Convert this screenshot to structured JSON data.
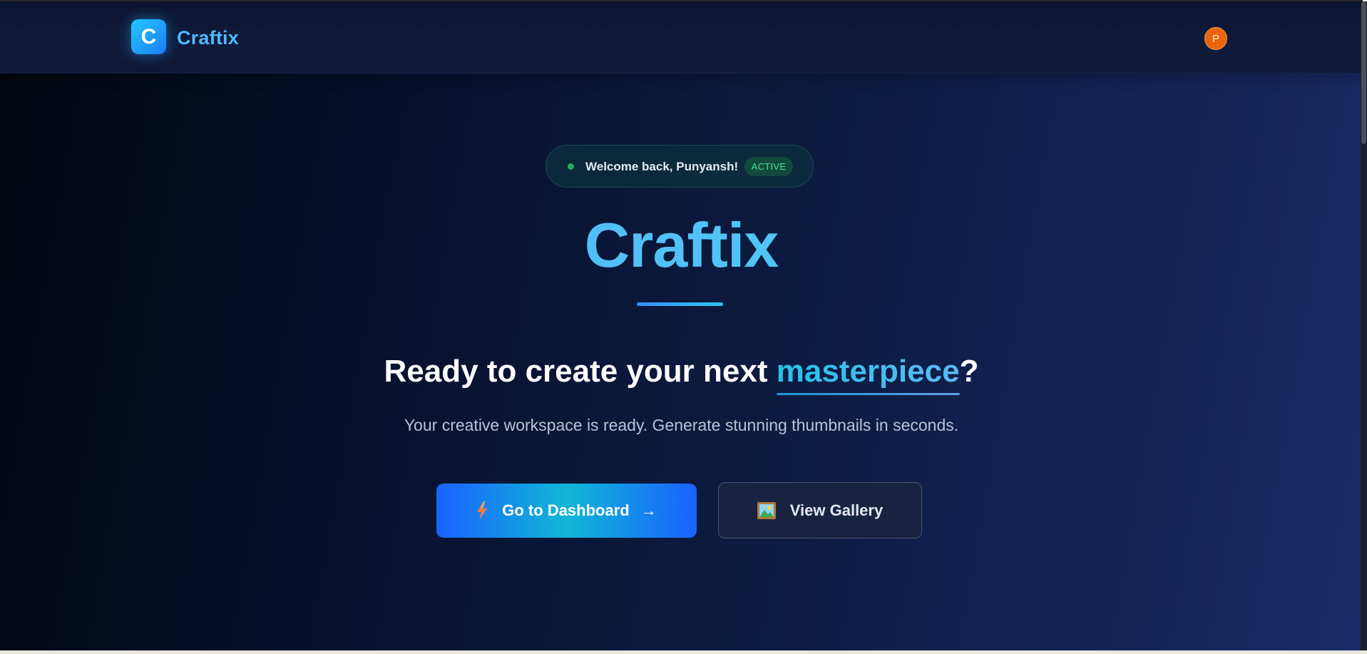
{
  "header": {
    "logo_letter": "C",
    "logo_text": "Craftix",
    "avatar_initial": "P"
  },
  "welcome": {
    "message": "Welcome back, Punyansh!",
    "status_badge": "ACTIVE"
  },
  "hero": {
    "title": "Craftix",
    "headline_before": "Ready to create your next ",
    "headline_accent": "masterpiece",
    "headline_after": "?",
    "subtitle": "Your creative workspace is ready. Generate stunning thumbnails in seconds."
  },
  "actions": {
    "primary_label": "Go to Dashboard",
    "primary_arrow": "→",
    "primary_icon": "lightning-bolt-icon",
    "secondary_label": "View Gallery",
    "secondary_icon": "framed-picture-icon"
  },
  "colors": {
    "brand_blue": "#4fb9ff",
    "accent_cyan": "#27c2ea",
    "active_green": "#4ce28e",
    "avatar_orange": "#e8650a",
    "background_dark": "#061029"
  }
}
